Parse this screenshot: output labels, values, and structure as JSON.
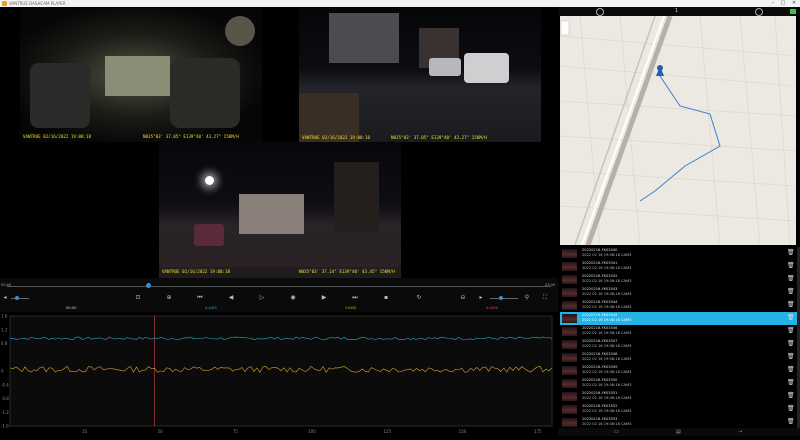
{
  "app": {
    "title": "VANTRUE DASHCAM PLAYER",
    "window_controls": [
      "–",
      "□",
      "✕"
    ]
  },
  "videos": {
    "interior": {
      "overlay_left": "VANTRUE 02/16/2022 19:08:18",
      "overlay_right": "N035°03' 37.05\" E139°40' 43.27\" 15KM/H"
    },
    "front": {
      "overlay_left": "VANTRUE 02/16/2022 19:08:18",
      "overlay_right": "N035°03' 37.05\" E139°40' 43.27\" 15KM/H"
    },
    "rear": {
      "overlay_left": "VANTRUE 02/16/2022 19:08:18",
      "overlay_right": "N035°03' 37.14\" E139°40' 43.45\" 15KM/H"
    }
  },
  "timeline": {
    "start_time": "00:00",
    "end_time": "03:00",
    "progress": 0.26
  },
  "volume": {
    "level": 0.35
  },
  "zoom": {
    "level": 0.4
  },
  "graph": {
    "labels": [
      "00:00",
      "X-AXIS",
      "Y-AXIS",
      "Z-AXIS"
    ],
    "label_colors": [
      "#cfcfcf",
      "#2aa7c8",
      "#d9a431",
      "#d84a4a"
    ],
    "y_ticks": [
      "1.6",
      "1.2",
      "0.8",
      "0",
      "-0.4",
      "-0.8",
      "-1.2",
      "-1.6"
    ],
    "x_ticks": [
      "25",
      "50",
      "75",
      "100",
      "125",
      "150",
      "175"
    ],
    "xlim": [
      0,
      180
    ],
    "ylim": [
      -1.6,
      1.6
    ],
    "cursor_x": 48
  },
  "map": {
    "page_indicator": "1",
    "top_icons": [
      "settings-icon",
      "help-icon",
      "battery-icon"
    ]
  },
  "files": [
    {
      "name": "20220216-FK03540",
      "date": "2022 02 16 19:08:18 CAM3"
    },
    {
      "name": "20220216-FK03541",
      "date": "2022 02 16 19:08:18 CAM3"
    },
    {
      "name": "20220216-FK03542",
      "date": "2022 02 16 19:08:18 CAM3"
    },
    {
      "name": "20220216-FK03543",
      "date": "2022 02 16 19:08:18 CAM3"
    },
    {
      "name": "20220216-FK03544",
      "date": "2022 02 16 19:08:18 CAM3"
    },
    {
      "name": "20220216-FK03545",
      "date": "2022 02 16 19:08:18 CAM3"
    },
    {
      "name": "20220216-FK03546",
      "date": "2022 02 16 19:08:18 CAM3"
    },
    {
      "name": "20220216-FK03547",
      "date": "2022 02 16 19:08:18 CAM3"
    },
    {
      "name": "20220216-FK03548",
      "date": "2022 02 16 19:08:18 CAM3"
    },
    {
      "name": "20220216-FK03549",
      "date": "2022 02 16 19:08:18 CAM3"
    },
    {
      "name": "20220216-FK03550",
      "date": "2022 02 16 19:08:18 CAM3"
    },
    {
      "name": "20220216-FK03551",
      "date": "2022 02 16 19:08:18 CAM3"
    },
    {
      "name": "20220216-FK03552",
      "date": "2022 02 16 19:08:18 CAM3"
    },
    {
      "name": "20220216-FK03553",
      "date": "2022 02 16 19:08:18 CAM3"
    }
  ],
  "selected_file_index": 5,
  "colors": {
    "accent": "#23b3e6",
    "overlay": "#e8e030",
    "x_series": "#2aa7c8",
    "y_series": "#d9a431",
    "cursor": "#d84a4a"
  }
}
